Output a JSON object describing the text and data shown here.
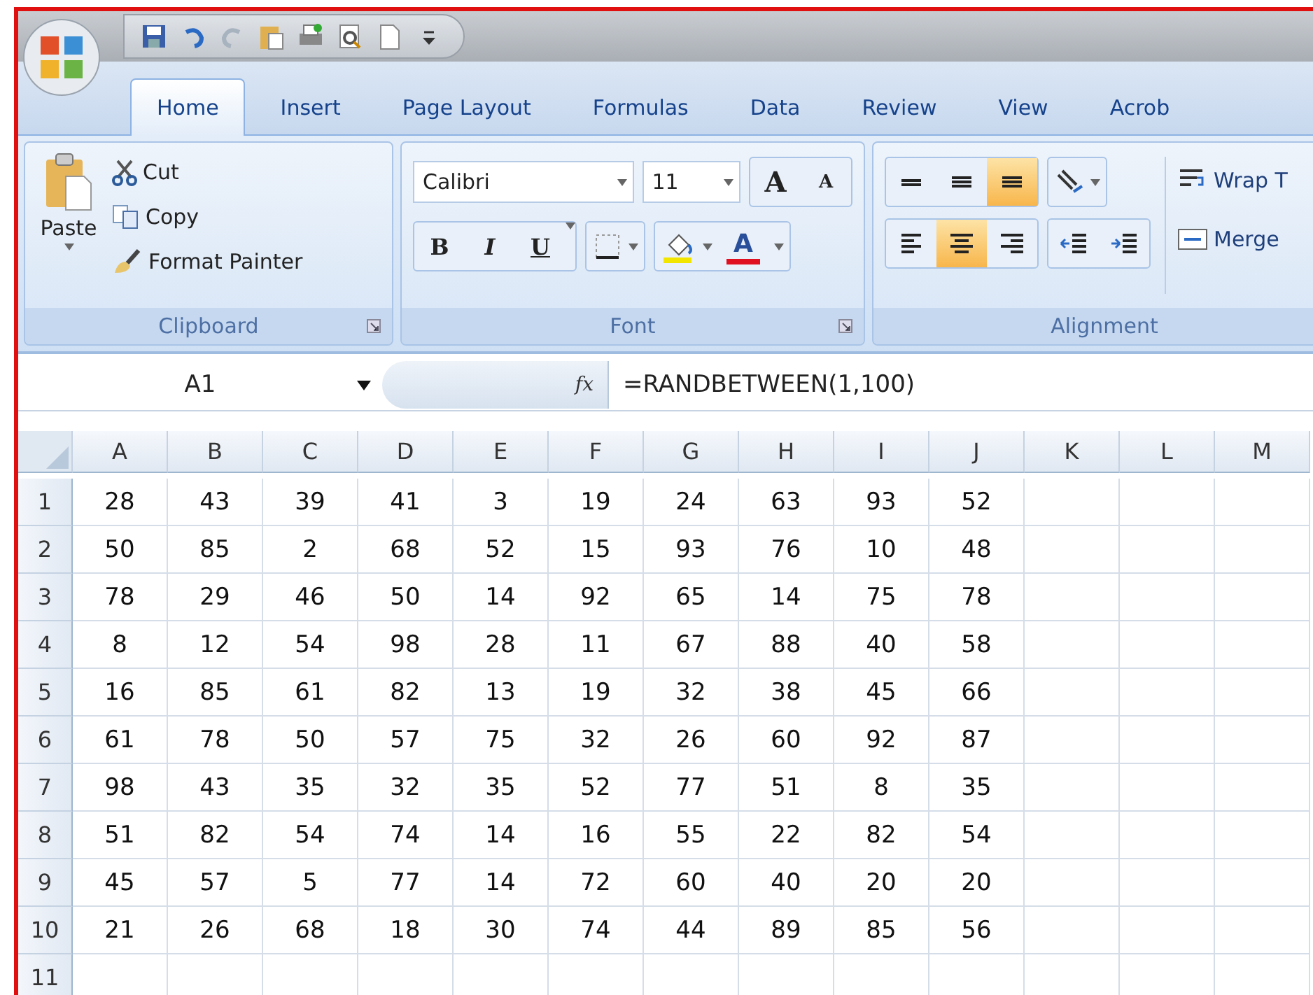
{
  "tabs": [
    {
      "label": "Home",
      "selected": true
    },
    {
      "label": "Insert",
      "selected": false
    },
    {
      "label": "Page Layout",
      "selected": false
    },
    {
      "label": "Formulas",
      "selected": false
    },
    {
      "label": "Data",
      "selected": false
    },
    {
      "label": "Review",
      "selected": false
    },
    {
      "label": "View",
      "selected": false
    },
    {
      "label": "Acrob",
      "selected": false
    }
  ],
  "clipboard": {
    "paste": "Paste",
    "cut": "Cut",
    "copy": "Copy",
    "format_painter": "Format Painter",
    "label": "Clipboard"
  },
  "font": {
    "name": "Calibri",
    "size": "11",
    "grow": "A",
    "shrink": "A",
    "bold": "B",
    "italic": "I",
    "underline": "U",
    "font_color": "A",
    "label": "Font"
  },
  "alignment": {
    "vertical": [
      {
        "kind": "top",
        "selected": false
      },
      {
        "kind": "middle",
        "selected": false
      },
      {
        "kind": "bottom",
        "selected": true
      }
    ],
    "horizontal": [
      {
        "kind": "left",
        "selected": false
      },
      {
        "kind": "center",
        "selected": true
      },
      {
        "kind": "right",
        "selected": false
      }
    ],
    "wrap": "Wrap T",
    "merge": "Merge",
    "label": "Alignment"
  },
  "formula_bar": {
    "name_box": "A1",
    "fx": "fx",
    "formula": "=RANDBETWEEN(1,100)"
  },
  "sheet": {
    "columns": [
      "A",
      "B",
      "C",
      "D",
      "E",
      "F",
      "G",
      "H",
      "I",
      "J",
      "K",
      "L",
      "M"
    ],
    "rows": [
      {
        "label": "1",
        "cells": [
          "28",
          "43",
          "39",
          "41",
          "3",
          "19",
          "24",
          "63",
          "93",
          "52"
        ]
      },
      {
        "label": "2",
        "cells": [
          "50",
          "85",
          "2",
          "68",
          "52",
          "15",
          "93",
          "76",
          "10",
          "48"
        ]
      },
      {
        "label": "3",
        "cells": [
          "78",
          "29",
          "46",
          "50",
          "14",
          "92",
          "65",
          "14",
          "75",
          "78"
        ]
      },
      {
        "label": "4",
        "cells": [
          "8",
          "12",
          "54",
          "98",
          "28",
          "11",
          "67",
          "88",
          "40",
          "58"
        ]
      },
      {
        "label": "5",
        "cells": [
          "16",
          "85",
          "61",
          "82",
          "13",
          "19",
          "32",
          "38",
          "45",
          "66"
        ]
      },
      {
        "label": "6",
        "cells": [
          "61",
          "78",
          "50",
          "57",
          "75",
          "32",
          "26",
          "60",
          "92",
          "87"
        ]
      },
      {
        "label": "7",
        "cells": [
          "98",
          "43",
          "35",
          "32",
          "35",
          "52",
          "77",
          "51",
          "8",
          "35"
        ]
      },
      {
        "label": "8",
        "cells": [
          "51",
          "82",
          "54",
          "74",
          "14",
          "16",
          "55",
          "22",
          "82",
          "54"
        ]
      },
      {
        "label": "9",
        "cells": [
          "45",
          "57",
          "5",
          "77",
          "14",
          "72",
          "60",
          "40",
          "20",
          "20"
        ]
      },
      {
        "label": "10",
        "cells": [
          "21",
          "26",
          "68",
          "18",
          "30",
          "74",
          "44",
          "89",
          "85",
          "56"
        ]
      },
      {
        "label": "11",
        "cells": []
      }
    ]
  }
}
